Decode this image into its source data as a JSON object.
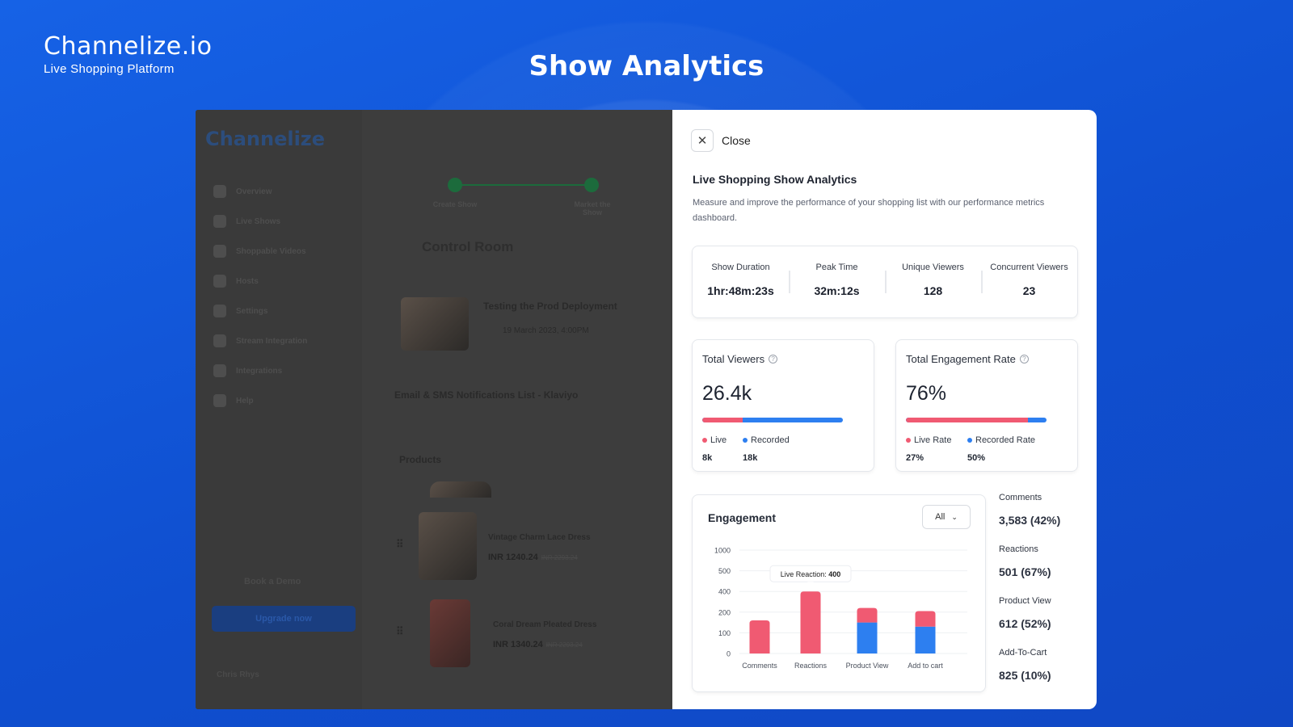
{
  "brand": {
    "logo_text": "Channelize.io",
    "tagline": "Live Shopping Platform"
  },
  "hero": {
    "title": "Show Analytics"
  },
  "background_app": {
    "logo_text": "Channelize",
    "nav_items": [
      {
        "label": "Overview",
        "icon": "home-icon"
      },
      {
        "label": "Live Shows",
        "icon": "video-icon"
      },
      {
        "label": "Shoppable Videos",
        "icon": "film-icon"
      },
      {
        "label": "Hosts",
        "icon": "user-icon"
      },
      {
        "label": "Settings",
        "icon": "gear-icon"
      },
      {
        "label": "Stream Integration",
        "icon": "stream-icon"
      },
      {
        "label": "Integrations",
        "icon": "plug-icon"
      },
      {
        "label": "Help",
        "icon": "help-icon"
      }
    ],
    "book_demo": "Book a Demo",
    "upgrade": "Upgrade now",
    "user_name": "Chris Rhys",
    "steps": [
      {
        "label": "Create Show"
      },
      {
        "label": "Market the Show"
      }
    ],
    "control_room": "Control Room",
    "show_title": "Testing the Prod Deployment",
    "show_date": "19 March 2023, 4:00PM",
    "notification_list": "Email & SMS Notifications List - Klaviyo",
    "products_heading": "Products",
    "products": [
      {
        "name": "Vintage Charm Lace Dress",
        "price": "INR 1240.24",
        "old_price": "INR 2293.24"
      },
      {
        "name": "Coral Dream Pleated Dress",
        "price": "INR 1340.24",
        "old_price": "INR 2293.24"
      }
    ]
  },
  "panel": {
    "close_label": "Close",
    "title": "Live Shopping Show Analytics",
    "description": "Measure and improve the performance of your shopping list with our performance metrics dashboard.",
    "stats": [
      {
        "label": "Show Duration",
        "value": "1hr:48m:23s"
      },
      {
        "label": "Peak Time",
        "value": "32m:12s"
      },
      {
        "label": "Unique Viewers",
        "value": "128"
      },
      {
        "label": "Concurrent Viewers",
        "value": "23"
      }
    ],
    "total_viewers": {
      "title": "Total Viewers",
      "value": "26.4k",
      "live_fraction": 0.29,
      "legend": [
        {
          "label": "Live",
          "value": "8k",
          "color": "#f05a72"
        },
        {
          "label": "Recorded",
          "value": "18k",
          "color": "#2d7ff0"
        }
      ]
    },
    "engagement_rate": {
      "title": "Total Engagement Rate",
      "value": "76%",
      "live_fraction": 0.87,
      "legend": [
        {
          "label": "Live Rate",
          "value": "27%",
          "color": "#f05a72"
        },
        {
          "label": "Recorded Rate",
          "value": "50%",
          "color": "#2d7ff0"
        }
      ]
    },
    "engagement": {
      "title": "Engagement",
      "filter_value": "All",
      "tooltip_label": "Live Reaction:",
      "tooltip_value": "400"
    },
    "metrics": [
      {
        "label": "Comments",
        "value": "3,583 (42%)"
      },
      {
        "label": "Reactions",
        "value": "501 (67%)"
      },
      {
        "label": "Product View",
        "value": "612 (52%)"
      },
      {
        "label": "Add-To-Cart",
        "value": "825 (10%)"
      }
    ]
  },
  "chart_data": {
    "type": "bar",
    "title": "Engagement",
    "categories": [
      "Comments",
      "Reactions",
      "Product View",
      "Add to cart"
    ],
    "y_ticks": [
      "1000",
      "500",
      "400",
      "200",
      "100",
      "0"
    ],
    "series": [
      {
        "name": "Recorded",
        "color": "#2d7ff0",
        "values": [
          0,
          0,
          150,
          130
        ]
      },
      {
        "name": "Live",
        "color": "#f05a72",
        "values": [
          160,
          400,
          90,
          80
        ]
      }
    ],
    "stacked": true,
    "grid": true
  }
}
